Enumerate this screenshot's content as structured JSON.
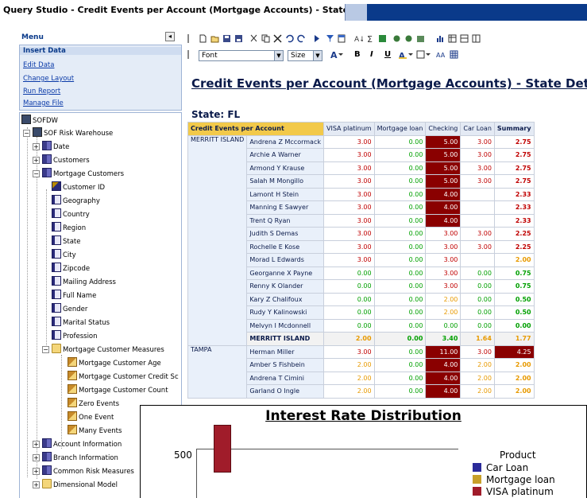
{
  "window": {
    "title": "Query Studio  - Credit Events per Account (Mortgage Accounts) - State Detail"
  },
  "menu": {
    "header": "Menu",
    "collapse_glyph": "◂",
    "items": [
      {
        "label": "Insert Data",
        "active": true
      },
      {
        "label": "Edit Data"
      },
      {
        "label": "Change Layout"
      },
      {
        "label": "Run Report"
      },
      {
        "label": "Manage File"
      }
    ]
  },
  "tree": {
    "root": "SOFDW",
    "nodes": [
      {
        "label": "SOF Risk Warehouse",
        "icon": "package-icon"
      },
      {
        "label": "Date",
        "icon": "dimension-icon"
      },
      {
        "label": "Customers",
        "icon": "dimension-icon"
      },
      {
        "label": "Mortgage Customers",
        "icon": "dimension-icon"
      },
      {
        "label": "Customer ID",
        "icon": "key-icon"
      },
      {
        "label": "Geography",
        "icon": "level-icon"
      },
      {
        "label": "Country",
        "icon": "level-icon"
      },
      {
        "label": "Region",
        "icon": "level-icon"
      },
      {
        "label": "State",
        "icon": "level-icon"
      },
      {
        "label": "City",
        "icon": "level-icon"
      },
      {
        "label": "Zipcode",
        "icon": "level-icon"
      },
      {
        "label": "Mailing Address",
        "icon": "level-icon"
      },
      {
        "label": "Full Name",
        "icon": "level-icon"
      },
      {
        "label": "Gender",
        "icon": "level-icon"
      },
      {
        "label": "Marital Status",
        "icon": "level-icon"
      },
      {
        "label": "Profession",
        "icon": "level-icon"
      },
      {
        "label": "Mortgage Customer Measures",
        "icon": "folder-icon"
      },
      {
        "label": "Mortgage Customer Age",
        "icon": "measure-icon"
      },
      {
        "label": "Mortgage Customer Credit Sc",
        "icon": "measure-icon"
      },
      {
        "label": "Mortgage Customer Count",
        "icon": "measure-icon"
      },
      {
        "label": "Zero Events",
        "icon": "measure-icon"
      },
      {
        "label": "One Event",
        "icon": "measure-icon"
      },
      {
        "label": "Many Events",
        "icon": "measure-icon"
      },
      {
        "label": "Account Information",
        "icon": "dimension-icon"
      },
      {
        "label": "Branch Information",
        "icon": "dimension-icon"
      },
      {
        "label": "Common Risk Measures",
        "icon": "dimension-icon"
      },
      {
        "label": "Dimensional Model",
        "icon": "folder-icon"
      }
    ]
  },
  "toolbar": {
    "font_value": "Font",
    "size_value": "Size",
    "bold": "B",
    "italic": "I",
    "underline": "U"
  },
  "report": {
    "title": "Credit Events per Account (Mortgage Accounts) - State Detail",
    "state_label": "State: FL",
    "corner": "Credit Events per Account",
    "columns": [
      "VISA platinum",
      "Mortgage loan",
      "Checking",
      "Car Loan",
      "Summary"
    ],
    "groups": [
      {
        "city": "MERRITT ISLAND",
        "rows": [
          {
            "name": "Andrena Z Mccormack",
            "v": [
              "3.00",
              "0.00",
              "5.00",
              "3.00",
              "2.75"
            ]
          },
          {
            "name": "Archie A Warner",
            "v": [
              "3.00",
              "0.00",
              "5.00",
              "3.00",
              "2.75"
            ]
          },
          {
            "name": "Armond Y Krause",
            "v": [
              "3.00",
              "0.00",
              "5.00",
              "3.00",
              "2.75"
            ]
          },
          {
            "name": "Salah M Mongillo",
            "v": [
              "3.00",
              "0.00",
              "5.00",
              "3.00",
              "2.75"
            ]
          },
          {
            "name": "Lamont H Stein",
            "v": [
              "3.00",
              "0.00",
              "4.00",
              "",
              "2.33"
            ]
          },
          {
            "name": "Manning E Sawyer",
            "v": [
              "3.00",
              "0.00",
              "4.00",
              "",
              "2.33"
            ]
          },
          {
            "name": "Trent Q Ryan",
            "v": [
              "3.00",
              "0.00",
              "4.00",
              "",
              "2.33"
            ]
          },
          {
            "name": "Judith S Demas",
            "v": [
              "3.00",
              "0.00",
              "3.00",
              "3.00",
              "2.25"
            ]
          },
          {
            "name": "Rochelle E Kose",
            "v": [
              "3.00",
              "0.00",
              "3.00",
              "3.00",
              "2.25"
            ]
          },
          {
            "name": "Morad L Edwards",
            "v": [
              "3.00",
              "0.00",
              "3.00",
              "",
              "2.00"
            ]
          },
          {
            "name": "Georganne X Payne",
            "v": [
              "0.00",
              "0.00",
              "3.00",
              "0.00",
              "0.75"
            ]
          },
          {
            "name": "Renny K Olander",
            "v": [
              "0.00",
              "0.00",
              "3.00",
              "0.00",
              "0.75"
            ]
          },
          {
            "name": "Kary Z Chalifoux",
            "v": [
              "0.00",
              "0.00",
              "2.00",
              "0.00",
              "0.50"
            ]
          },
          {
            "name": "Rudy Y Kalinowski",
            "v": [
              "0.00",
              "0.00",
              "2.00",
              "0.00",
              "0.50"
            ]
          },
          {
            "name": "Melvyn I Mcdonnell",
            "v": [
              "0.00",
              "0.00",
              "0.00",
              "0.00",
              "0.00"
            ]
          }
        ],
        "total": {
          "name": "MERRITT ISLAND",
          "v": [
            "2.00",
            "0.00",
            "3.40",
            "1.64",
            "1.77"
          ]
        }
      },
      {
        "city": "TAMPA",
        "rows": [
          {
            "name": "Herman Miller",
            "v": [
              "3.00",
              "0.00",
              "11.00",
              "3.00",
              "4.25"
            ]
          },
          {
            "name": "Amber S Fishbein",
            "v": [
              "2.00",
              "0.00",
              "4.00",
              "2.00",
              "2.00"
            ]
          },
          {
            "name": "Andrena T Cimini",
            "v": [
              "2.00",
              "0.00",
              "4.00",
              "2.00",
              "2.00"
            ]
          },
          {
            "name": "Garland O Ingle",
            "v": [
              "2.00",
              "0.00",
              "4.00",
              "2.00",
              "2.00"
            ]
          }
        ]
      }
    ]
  },
  "chart_data": {
    "type": "bar",
    "title": "Interest Rate Distribution",
    "y_tick_label": "500",
    "legend_title": "Product",
    "legend_placement": "right",
    "series": [
      {
        "name": "Car Loan",
        "color": "#2b2b9a"
      },
      {
        "name": "Mortgage loan",
        "color": "#c8a02a"
      },
      {
        "name": "VISA platinum",
        "color": "#a01c2a"
      }
    ]
  }
}
